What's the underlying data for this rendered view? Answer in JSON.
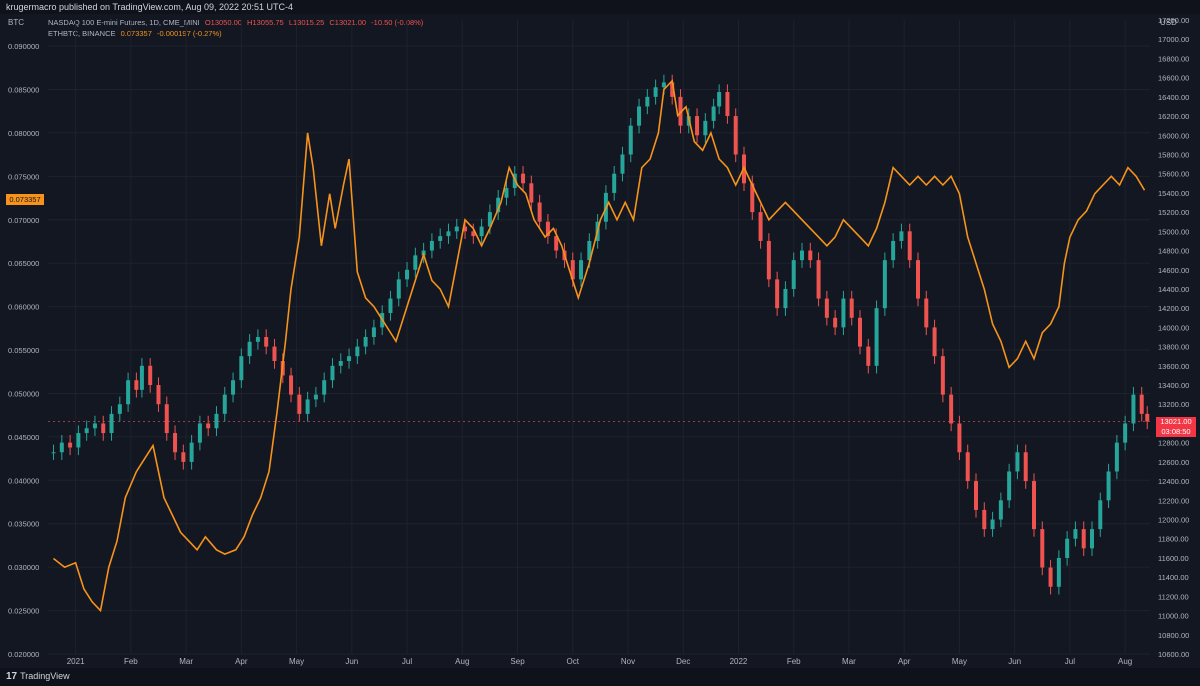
{
  "header": {
    "publisher_text": "krugermacro published on TradingView.com, Aug 09, 2022 20:51 UTC-4"
  },
  "footer": {
    "brand": "TradingView",
    "brand_mark": "17"
  },
  "legend": {
    "nq": {
      "title": "NASDAQ 100 E-mini Futures, 1D, CME_MINI",
      "o": "O13050.00",
      "h": "H13055.75",
      "l": "L13015.25",
      "c": "C13021.00",
      "chg": "-10.50 (-0.08%)"
    },
    "eth": {
      "title": "ETHBTC, BINANCE",
      "last": "0.073357",
      "chg": "-0.000197 (-0.27%)"
    }
  },
  "colors": {
    "eth_line": "#f7931a",
    "up": "#26a69a",
    "down": "#ef5350",
    "bg": "#131722",
    "grid": "#1e222d"
  },
  "chart_data": {
    "type": "line",
    "left_axis": {
      "unit_label": "BTC",
      "ylim": [
        0.02,
        0.093
      ],
      "ticks": [
        "0.090000",
        "0.085000",
        "0.080000",
        "0.075000",
        "0.070000",
        "0.065000",
        "0.060000",
        "0.055000",
        "0.050000",
        "0.045000",
        "0.040000",
        "0.035000",
        "0.030000",
        "0.025000",
        "0.020000"
      ],
      "last_value_tag": "0.073357"
    },
    "right_axis": {
      "unit_label": "USD",
      "ylim": [
        10600,
        17200
      ],
      "ticks": [
        "17200.00",
        "17000.00",
        "16800.00",
        "16600.00",
        "16400.00",
        "16200.00",
        "16000.00",
        "15800.00",
        "15600.00",
        "15400.00",
        "15200.00",
        "15000.00",
        "14800.00",
        "14600.00",
        "14400.00",
        "14200.00",
        "14000.00",
        "13800.00",
        "13600.00",
        "13400.00",
        "13200.00",
        "13000.00",
        "12800.00",
        "12600.00",
        "12400.00",
        "12200.00",
        "12000.00",
        "11800.00",
        "11600.00",
        "11400.00",
        "11200.00",
        "11000.00",
        "10800.00",
        "10600.00"
      ],
      "last_value_tag": "13021.00",
      "countdown": "03:08:50"
    },
    "x_labels": [
      {
        "label": "2021",
        "t": 0.4
      },
      {
        "label": "Feb",
        "t": 1.4
      },
      {
        "label": "Mar",
        "t": 2.4
      },
      {
        "label": "Apr",
        "t": 3.4
      },
      {
        "label": "May",
        "t": 4.4
      },
      {
        "label": "Jun",
        "t": 5.4
      },
      {
        "label": "Jul",
        "t": 6.4
      },
      {
        "label": "Aug",
        "t": 7.4
      },
      {
        "label": "Sep",
        "t": 8.4
      },
      {
        "label": "Oct",
        "t": 9.4
      },
      {
        "label": "Nov",
        "t": 10.4
      },
      {
        "label": "Dec",
        "t": 11.4
      },
      {
        "label": "2022",
        "t": 12.4
      },
      {
        "label": "Feb",
        "t": 13.4
      },
      {
        "label": "Mar",
        "t": 14.4
      },
      {
        "label": "Apr",
        "t": 15.4
      },
      {
        "label": "May",
        "t": 16.4
      },
      {
        "label": "Jun",
        "t": 17.4
      },
      {
        "label": "Jul",
        "t": 18.4
      },
      {
        "label": "Aug",
        "t": 19.4
      }
    ],
    "xlim": [
      -0.1,
      19.85
    ],
    "series": [
      {
        "axis": "left",
        "style": "line",
        "points": [
          [
            0,
            0.031
          ],
          [
            0.2,
            0.03
          ],
          [
            0.4,
            0.0305
          ],
          [
            0.55,
            0.0275
          ],
          [
            0.7,
            0.026
          ],
          [
            0.85,
            0.025
          ],
          [
            1.0,
            0.03
          ],
          [
            1.15,
            0.033
          ],
          [
            1.3,
            0.038
          ],
          [
            1.5,
            0.041
          ],
          [
            1.65,
            0.0425
          ],
          [
            1.8,
            0.044
          ],
          [
            2.0,
            0.038
          ],
          [
            2.15,
            0.036
          ],
          [
            2.3,
            0.034
          ],
          [
            2.45,
            0.033
          ],
          [
            2.6,
            0.032
          ],
          [
            2.75,
            0.0335
          ],
          [
            2.95,
            0.032
          ],
          [
            3.1,
            0.0315
          ],
          [
            3.3,
            0.032
          ],
          [
            3.45,
            0.0335
          ],
          [
            3.6,
            0.036
          ],
          [
            3.75,
            0.038
          ],
          [
            3.9,
            0.041
          ],
          [
            4.05,
            0.048
          ],
          [
            4.2,
            0.056
          ],
          [
            4.3,
            0.062
          ],
          [
            4.45,
            0.068
          ],
          [
            4.6,
            0.08
          ],
          [
            4.7,
            0.076
          ],
          [
            4.85,
            0.067
          ],
          [
            5.0,
            0.073
          ],
          [
            5.1,
            0.069
          ],
          [
            5.25,
            0.074
          ],
          [
            5.35,
            0.077
          ],
          [
            5.5,
            0.064
          ],
          [
            5.65,
            0.061
          ],
          [
            5.8,
            0.06
          ],
          [
            6.0,
            0.058
          ],
          [
            6.2,
            0.056
          ],
          [
            6.4,
            0.06
          ],
          [
            6.55,
            0.063
          ],
          [
            6.7,
            0.066
          ],
          [
            6.85,
            0.063
          ],
          [
            7.0,
            0.062
          ],
          [
            7.15,
            0.06
          ],
          [
            7.3,
            0.065
          ],
          [
            7.45,
            0.07
          ],
          [
            7.6,
            0.069
          ],
          [
            7.75,
            0.067
          ],
          [
            7.9,
            0.069
          ],
          [
            8.1,
            0.072
          ],
          [
            8.25,
            0.076
          ],
          [
            8.4,
            0.074
          ],
          [
            8.55,
            0.073
          ],
          [
            8.7,
            0.07
          ],
          [
            8.9,
            0.068
          ],
          [
            9.05,
            0.069
          ],
          [
            9.2,
            0.067
          ],
          [
            9.35,
            0.064
          ],
          [
            9.5,
            0.061
          ],
          [
            9.7,
            0.065
          ],
          [
            9.9,
            0.07
          ],
          [
            10.05,
            0.072
          ],
          [
            10.2,
            0.07
          ],
          [
            10.35,
            0.072
          ],
          [
            10.5,
            0.07
          ],
          [
            10.65,
            0.076
          ],
          [
            10.8,
            0.077
          ],
          [
            10.95,
            0.08
          ],
          [
            11.05,
            0.085
          ],
          [
            11.2,
            0.086
          ],
          [
            11.3,
            0.082
          ],
          [
            11.45,
            0.083
          ],
          [
            11.6,
            0.079
          ],
          [
            11.75,
            0.078
          ],
          [
            11.9,
            0.08
          ],
          [
            12.05,
            0.077
          ],
          [
            12.2,
            0.076
          ],
          [
            12.35,
            0.074
          ],
          [
            12.5,
            0.076
          ],
          [
            12.65,
            0.074
          ],
          [
            12.8,
            0.072
          ],
          [
            12.95,
            0.07
          ],
          [
            13.1,
            0.071
          ],
          [
            13.25,
            0.072
          ],
          [
            13.4,
            0.071
          ],
          [
            13.55,
            0.07
          ],
          [
            13.7,
            0.069
          ],
          [
            13.85,
            0.068
          ],
          [
            14.0,
            0.067
          ],
          [
            14.15,
            0.068
          ],
          [
            14.3,
            0.07
          ],
          [
            14.45,
            0.069
          ],
          [
            14.6,
            0.068
          ],
          [
            14.75,
            0.067
          ],
          [
            14.9,
            0.069
          ],
          [
            15.05,
            0.072
          ],
          [
            15.2,
            0.076
          ],
          [
            15.35,
            0.075
          ],
          [
            15.5,
            0.074
          ],
          [
            15.65,
            0.075
          ],
          [
            15.8,
            0.074
          ],
          [
            15.95,
            0.075
          ],
          [
            16.1,
            0.074
          ],
          [
            16.25,
            0.075
          ],
          [
            16.4,
            0.073
          ],
          [
            16.55,
            0.068
          ],
          [
            16.7,
            0.065
          ],
          [
            16.85,
            0.062
          ],
          [
            17.0,
            0.058
          ],
          [
            17.15,
            0.056
          ],
          [
            17.3,
            0.053
          ],
          [
            17.45,
            0.054
          ],
          [
            17.6,
            0.056
          ],
          [
            17.75,
            0.054
          ],
          [
            17.9,
            0.057
          ],
          [
            18.05,
            0.058
          ],
          [
            18.2,
            0.06
          ],
          [
            18.3,
            0.065
          ],
          [
            18.4,
            0.068
          ],
          [
            18.55,
            0.07
          ],
          [
            18.7,
            0.071
          ],
          [
            18.85,
            0.073
          ],
          [
            19.0,
            0.074
          ],
          [
            19.15,
            0.075
          ],
          [
            19.3,
            0.074
          ],
          [
            19.45,
            0.076
          ],
          [
            19.6,
            0.075
          ],
          [
            19.75,
            0.0734
          ]
        ]
      },
      {
        "axis": "right",
        "style": "candlestick",
        "points": [
          [
            0,
            12700
          ],
          [
            0.15,
            12800
          ],
          [
            0.3,
            12750
          ],
          [
            0.45,
            12900
          ],
          [
            0.6,
            12950
          ],
          [
            0.75,
            13000
          ],
          [
            0.9,
            12900
          ],
          [
            1.05,
            13100
          ],
          [
            1.2,
            13200
          ],
          [
            1.35,
            13450
          ],
          [
            1.5,
            13350
          ],
          [
            1.6,
            13600
          ],
          [
            1.75,
            13400
          ],
          [
            1.9,
            13200
          ],
          [
            2.05,
            12900
          ],
          [
            2.2,
            12700
          ],
          [
            2.35,
            12600
          ],
          [
            2.5,
            12800
          ],
          [
            2.65,
            13000
          ],
          [
            2.8,
            12950
          ],
          [
            2.95,
            13100
          ],
          [
            3.1,
            13300
          ],
          [
            3.25,
            13450
          ],
          [
            3.4,
            13700
          ],
          [
            3.55,
            13850
          ],
          [
            3.7,
            13900
          ],
          [
            3.85,
            13800
          ],
          [
            4.0,
            13650
          ],
          [
            4.15,
            13500
          ],
          [
            4.3,
            13300
          ],
          [
            4.45,
            13100
          ],
          [
            4.6,
            13250
          ],
          [
            4.75,
            13300
          ],
          [
            4.9,
            13450
          ],
          [
            5.05,
            13600
          ],
          [
            5.2,
            13650
          ],
          [
            5.35,
            13700
          ],
          [
            5.5,
            13800
          ],
          [
            5.65,
            13900
          ],
          [
            5.8,
            14000
          ],
          [
            5.95,
            14150
          ],
          [
            6.1,
            14300
          ],
          [
            6.25,
            14500
          ],
          [
            6.4,
            14600
          ],
          [
            6.55,
            14750
          ],
          [
            6.7,
            14800
          ],
          [
            6.85,
            14900
          ],
          [
            7.0,
            14950
          ],
          [
            7.15,
            15000
          ],
          [
            7.3,
            15050
          ],
          [
            7.45,
            15000
          ],
          [
            7.6,
            14950
          ],
          [
            7.75,
            15050
          ],
          [
            7.9,
            15200
          ],
          [
            8.05,
            15350
          ],
          [
            8.2,
            15450
          ],
          [
            8.35,
            15600
          ],
          [
            8.5,
            15500
          ],
          [
            8.65,
            15300
          ],
          [
            8.8,
            15100
          ],
          [
            8.95,
            14950
          ],
          [
            9.1,
            14800
          ],
          [
            9.25,
            14700
          ],
          [
            9.4,
            14500
          ],
          [
            9.55,
            14700
          ],
          [
            9.7,
            14900
          ],
          [
            9.85,
            15100
          ],
          [
            10.0,
            15400
          ],
          [
            10.15,
            15600
          ],
          [
            10.3,
            15800
          ],
          [
            10.45,
            16100
          ],
          [
            10.6,
            16300
          ],
          [
            10.75,
            16400
          ],
          [
            10.9,
            16500
          ],
          [
            11.05,
            16550
          ],
          [
            11.2,
            16400
          ],
          [
            11.35,
            16100
          ],
          [
            11.5,
            16200
          ],
          [
            11.65,
            16000
          ],
          [
            11.8,
            16150
          ],
          [
            11.95,
            16300
          ],
          [
            12.05,
            16450
          ],
          [
            12.2,
            16200
          ],
          [
            12.35,
            15800
          ],
          [
            12.5,
            15500
          ],
          [
            12.65,
            15200
          ],
          [
            12.8,
            14900
          ],
          [
            12.95,
            14500
          ],
          [
            13.1,
            14200
          ],
          [
            13.25,
            14400
          ],
          [
            13.4,
            14700
          ],
          [
            13.55,
            14800
          ],
          [
            13.7,
            14700
          ],
          [
            13.85,
            14300
          ],
          [
            14.0,
            14100
          ],
          [
            14.15,
            14000
          ],
          [
            14.3,
            14300
          ],
          [
            14.45,
            14100
          ],
          [
            14.6,
            13800
          ],
          [
            14.75,
            13600
          ],
          [
            14.9,
            14200
          ],
          [
            15.05,
            14700
          ],
          [
            15.2,
            14900
          ],
          [
            15.35,
            15000
          ],
          [
            15.5,
            14700
          ],
          [
            15.65,
            14300
          ],
          [
            15.8,
            14000
          ],
          [
            15.95,
            13700
          ],
          [
            16.1,
            13300
          ],
          [
            16.25,
            13000
          ],
          [
            16.4,
            12700
          ],
          [
            16.55,
            12400
          ],
          [
            16.7,
            12100
          ],
          [
            16.85,
            11900
          ],
          [
            17.0,
            12000
          ],
          [
            17.15,
            12200
          ],
          [
            17.3,
            12500
          ],
          [
            17.45,
            12700
          ],
          [
            17.6,
            12400
          ],
          [
            17.75,
            11900
          ],
          [
            17.9,
            11500
          ],
          [
            18.05,
            11300
          ],
          [
            18.2,
            11600
          ],
          [
            18.35,
            11800
          ],
          [
            18.5,
            11900
          ],
          [
            18.65,
            11700
          ],
          [
            18.8,
            11900
          ],
          [
            18.95,
            12200
          ],
          [
            19.1,
            12500
          ],
          [
            19.25,
            12800
          ],
          [
            19.4,
            13000
          ],
          [
            19.55,
            13300
          ],
          [
            19.7,
            13100
          ],
          [
            19.8,
            13021
          ]
        ]
      }
    ]
  }
}
